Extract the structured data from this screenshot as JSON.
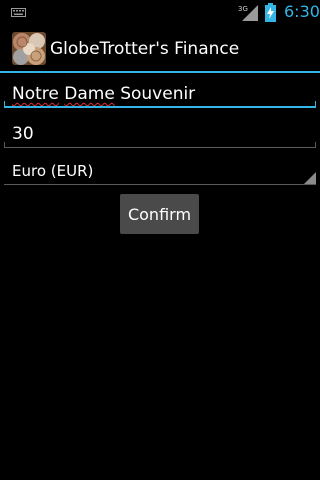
{
  "status_bar": {
    "time": "6:30",
    "network_type": "3G",
    "icons": [
      "keyboard-icon",
      "signal-icon",
      "battery-charging-icon"
    ],
    "accent_color": "#33b5e5"
  },
  "action_bar": {
    "app_icon": "coins-icon",
    "title": "GlobeTrotter's Finance"
  },
  "form": {
    "item_name": {
      "value_words": [
        "Notre",
        "Dame",
        "Souvenir"
      ],
      "misspelled_words": [
        "Notre",
        "Dame"
      ]
    },
    "amount": {
      "value": "30"
    },
    "currency": {
      "selected": "Euro (EUR)",
      "icon": "dropdown-triangle-icon"
    },
    "confirm_label": "Confirm"
  }
}
